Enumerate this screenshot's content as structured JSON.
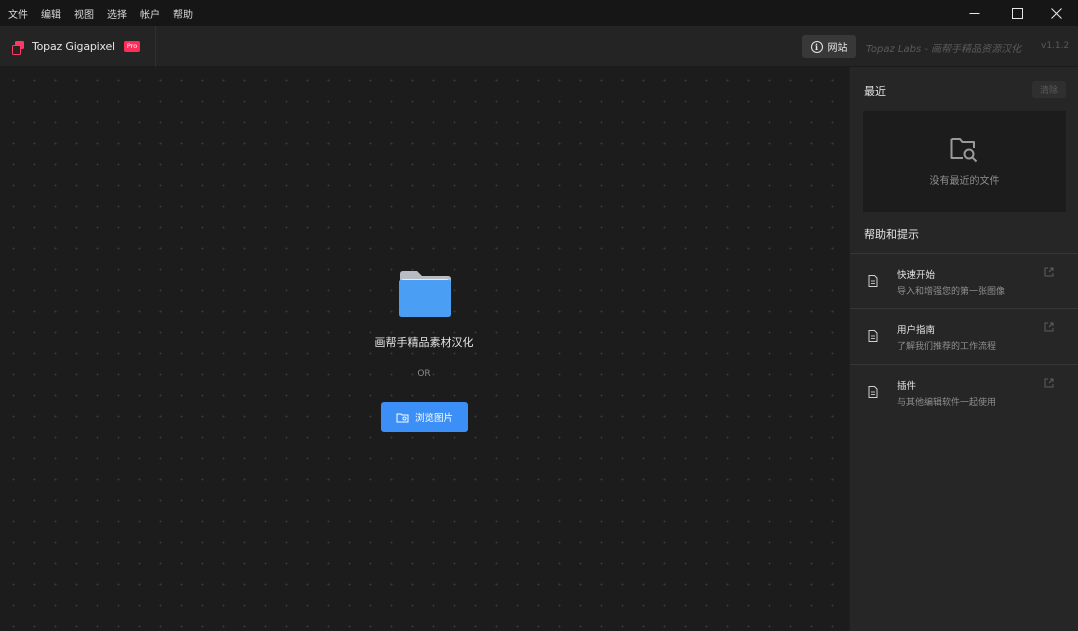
{
  "menu": {
    "items": [
      "文件",
      "编辑",
      "视图",
      "选择",
      "帐户",
      "帮助"
    ]
  },
  "window_controls": [
    "minimize-icon",
    "maximize-icon",
    "close-icon"
  ],
  "header": {
    "app_name": "Topaz Gigapixel",
    "badge": "Pro",
    "website_button": "网站",
    "brand_note": "Topaz Labs - 画帮手精品资源汉化",
    "version": "v1.1.2"
  },
  "canvas": {
    "drop_text": "画帮手精品素材汉化",
    "or_text": "OR",
    "browse_button": "浏览图片"
  },
  "sidebar": {
    "recent_title": "最近",
    "clear_button": "清除",
    "recent_empty": "没有最近的文件",
    "help_title": "帮助和提示",
    "help_items": [
      {
        "title": "快速开始",
        "subtitle": "导入和增强您的第一张图像"
      },
      {
        "title": "用户指南",
        "subtitle": "了解我们推荐的工作流程"
      },
      {
        "title": "插件",
        "subtitle": "与其他编辑软件一起使用"
      }
    ]
  },
  "colors": {
    "accent_blue": "#3b8ff6",
    "brand_pink": "#ff2d5a",
    "folder_blue": "#4a9ff5"
  }
}
